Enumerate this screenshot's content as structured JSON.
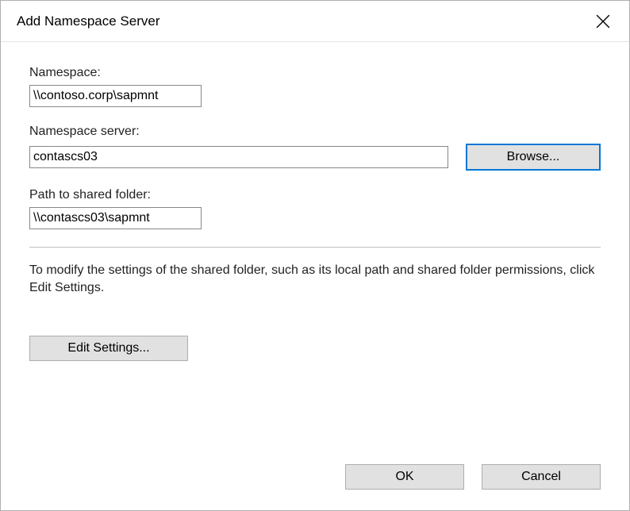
{
  "title": "Add Namespace Server",
  "labels": {
    "namespace": "Namespace:",
    "server": "Namespace server:",
    "path": "Path to shared folder:"
  },
  "values": {
    "namespace": "\\\\contoso.corp\\sapmnt",
    "server": "contascs03",
    "path": "\\\\contascs03\\sapmnt"
  },
  "buttons": {
    "browse": "Browse...",
    "edit_settings": "Edit Settings...",
    "ok": "OK",
    "cancel": "Cancel"
  },
  "info_text": "To modify the settings of the shared folder, such as its local path and shared folder permissions, click Edit Settings."
}
